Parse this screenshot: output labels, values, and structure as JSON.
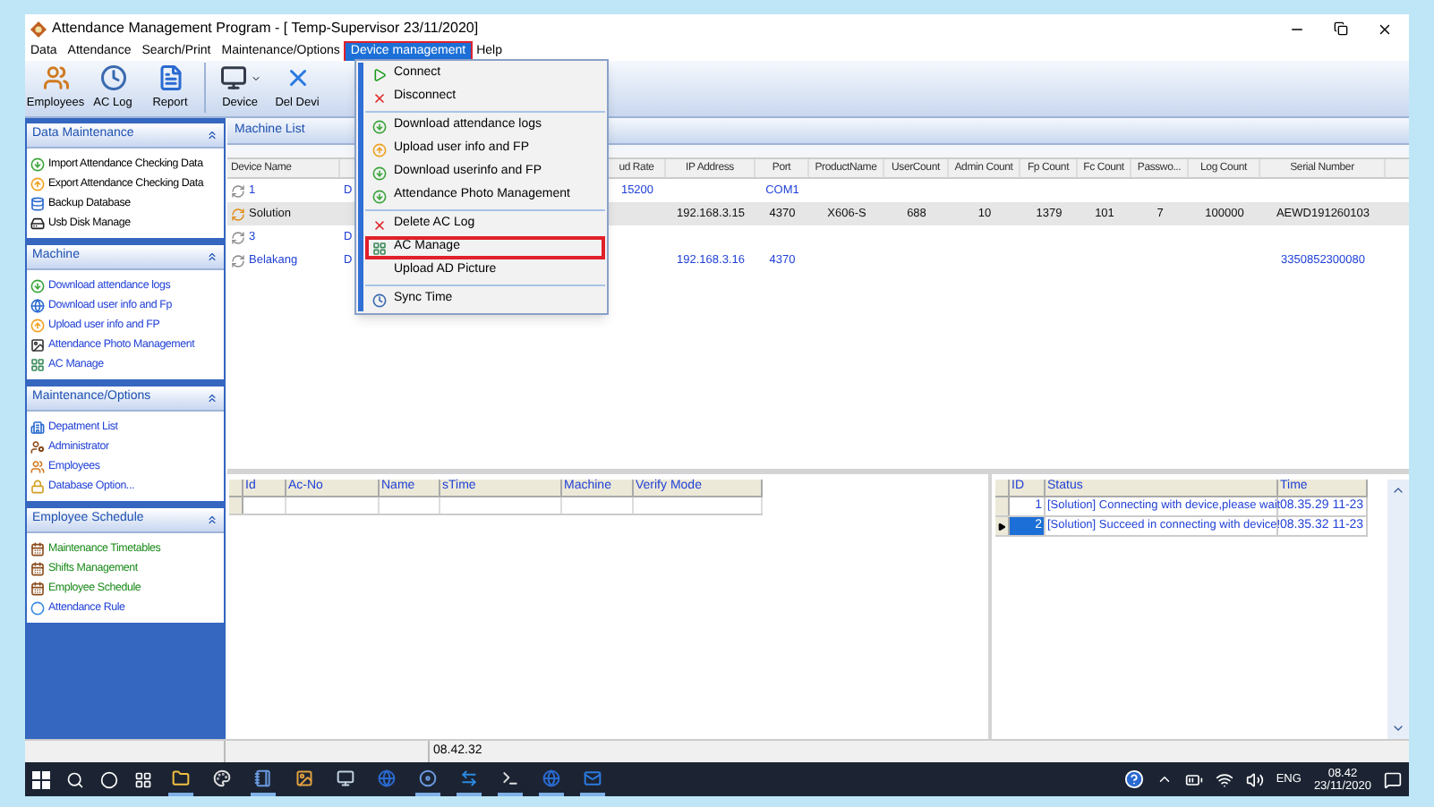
{
  "window": {
    "title": "Attendance Management Program - [ Temp-Supervisor 23/11/2020]"
  },
  "menu_bar": [
    {
      "label": "Data",
      "selected": false
    },
    {
      "label": "Attendance",
      "selected": false
    },
    {
      "label": "Search/Print",
      "selected": false
    },
    {
      "label": "Maintenance/Options",
      "selected": false
    },
    {
      "label": "Device management",
      "selected": true
    },
    {
      "label": "Help",
      "selected": false
    }
  ],
  "toolbar": [
    {
      "label": "Employees",
      "kind": "employees"
    },
    {
      "label": "AC Log",
      "kind": "clock"
    },
    {
      "label": "Report",
      "kind": "report"
    },
    {
      "label": "Device",
      "kind": "device"
    },
    {
      "label": "Del Devi",
      "kind": "delete"
    }
  ],
  "dropdown": {
    "groups": [
      {
        "items": [
          {
            "label": "Connect",
            "kind": "connect",
            "highlighted": false
          },
          {
            "label": "Disconnect",
            "kind": "disconnect",
            "highlighted": false
          }
        ]
      },
      {
        "items": [
          {
            "label": "Download attendance logs",
            "kind": "download",
            "highlighted": false
          },
          {
            "label": "Upload user info and FP",
            "kind": "upload",
            "highlighted": false
          },
          {
            "label": "Download userinfo and FP",
            "kind": "download",
            "highlighted": false
          },
          {
            "label": "Attendance Photo Management",
            "kind": "download",
            "highlighted": false
          }
        ]
      },
      {
        "items": [
          {
            "label": "Delete AC Log",
            "kind": "disconnect",
            "highlighted": false
          },
          {
            "label": "AC Manage",
            "kind": "grid",
            "highlighted": true
          },
          {
            "label": "Upload AD Picture",
            "kind": "none",
            "highlighted": false
          }
        ]
      },
      {
        "items": [
          {
            "label": "Sync Time",
            "kind": "clock",
            "highlighted": false
          }
        ]
      }
    ]
  },
  "sidebar": {
    "sections": [
      {
        "title": "Data Maintenance",
        "items": [
          {
            "label": "Import Attendance Checking Data",
            "kind": "download",
            "color": "#000000"
          },
          {
            "label": "Export Attendance Checking Data",
            "kind": "upload",
            "color": "#000000"
          },
          {
            "label": "Backup Database",
            "kind": "database",
            "color": "#000000"
          },
          {
            "label": "Usb Disk Manage",
            "kind": "usb",
            "color": "#000000"
          }
        ]
      },
      {
        "title": "Machine",
        "items": [
          {
            "label": "Download attendance logs",
            "kind": "download",
            "color": "#1f3fd6"
          },
          {
            "label": "Download user info and Fp",
            "kind": "globe",
            "color": "#1f3fd6"
          },
          {
            "label": "Upload user info and FP",
            "kind": "upload",
            "color": "#1f3fd6"
          },
          {
            "label": "Attendance Photo Management",
            "kind": "photo",
            "color": "#1f3fd6"
          },
          {
            "label": "AC Manage",
            "kind": "grid",
            "color": "#1f3fd6"
          }
        ]
      },
      {
        "title": "Maintenance/Options",
        "items": [
          {
            "label": "Depatment List",
            "kind": "building",
            "color": "#1f3fd6"
          },
          {
            "label": "Administrator",
            "kind": "admin",
            "color": "#1f3fd6"
          },
          {
            "label": "Employees",
            "kind": "employees",
            "color": "#1f3fd6"
          },
          {
            "label": "Database Option...",
            "kind": "lock",
            "color": "#1f3fd6"
          }
        ]
      },
      {
        "title": "Employee Schedule",
        "items": [
          {
            "label": "Maintenance Timetables",
            "kind": "calendar",
            "color": "#1a8a1a"
          },
          {
            "label": "Shifts Management",
            "kind": "calendar",
            "color": "#1a8a1a"
          },
          {
            "label": "Employee Schedule",
            "kind": "calendar",
            "color": "#1a8a1a"
          },
          {
            "label": "Attendance Rule",
            "kind": "dot",
            "color": "#1f3fd6"
          }
        ]
      }
    ]
  },
  "machine_list": {
    "title": "Machine List",
    "columns": [
      "Device Name",
      null,
      "ud Rate",
      "IP Address",
      "Port",
      "ProductName",
      "UserCount",
      "Admin Count",
      "Fp Count",
      "Fc Count",
      "Passwo...",
      "Log Count",
      "Serial Number"
    ],
    "rows": [
      {
        "connected": false,
        "selected": false,
        "cells": [
          "1",
          "D",
          "15200",
          null,
          "COM1",
          null,
          null,
          null,
          null,
          null,
          null,
          null,
          null
        ]
      },
      {
        "connected": true,
        "selected": true,
        "cells": [
          "Solution",
          null,
          null,
          "192.168.3.15",
          "4370",
          "X606-S",
          "688",
          "10",
          "1379",
          "101",
          "7",
          "100000",
          "AEWD191260103"
        ]
      },
      {
        "connected": false,
        "selected": false,
        "cells": [
          "3",
          "D",
          null,
          null,
          null,
          null,
          null,
          null,
          null,
          null,
          null,
          null,
          null
        ]
      },
      {
        "connected": false,
        "selected": false,
        "cells": [
          "Belakang",
          "D",
          null,
          "192.168.3.16",
          "4370",
          null,
          null,
          null,
          null,
          null,
          null,
          null,
          "3350852300080"
        ]
      }
    ]
  },
  "records_table": {
    "columns": [
      "Id",
      "Ac-No",
      "Name",
      "sTime",
      "Machine",
      "Verify Mode"
    ]
  },
  "log_table": {
    "columns": [
      "ID",
      "Status",
      "Time"
    ],
    "rows": [
      {
        "selected": false,
        "id": "1",
        "status": "[Solution] Connecting with device,please wait",
        "time": "08.35.29 11-23"
      },
      {
        "selected": true,
        "id": "2",
        "status": "[Solution] Succeed in connecting with device!",
        "time": "08.35.32 11-23"
      }
    ]
  },
  "status_bar": {
    "time": "08.42.32"
  },
  "taskbar": {
    "apps": [
      {
        "kind": "folder",
        "running": true
      },
      {
        "kind": "palette",
        "running": false
      },
      {
        "kind": "notebook",
        "running": true
      },
      {
        "kind": "picture",
        "running": false
      },
      {
        "kind": "monitor",
        "running": false
      },
      {
        "kind": "globe",
        "running": false
      },
      {
        "kind": "disc",
        "running": true
      },
      {
        "kind": "arrows",
        "running": true
      },
      {
        "kind": "terminal",
        "running": true
      },
      {
        "kind": "globe",
        "running": true
      },
      {
        "kind": "mail",
        "running": true
      }
    ],
    "language": "ENG",
    "time": "08.42",
    "date": "23/11/2020"
  }
}
